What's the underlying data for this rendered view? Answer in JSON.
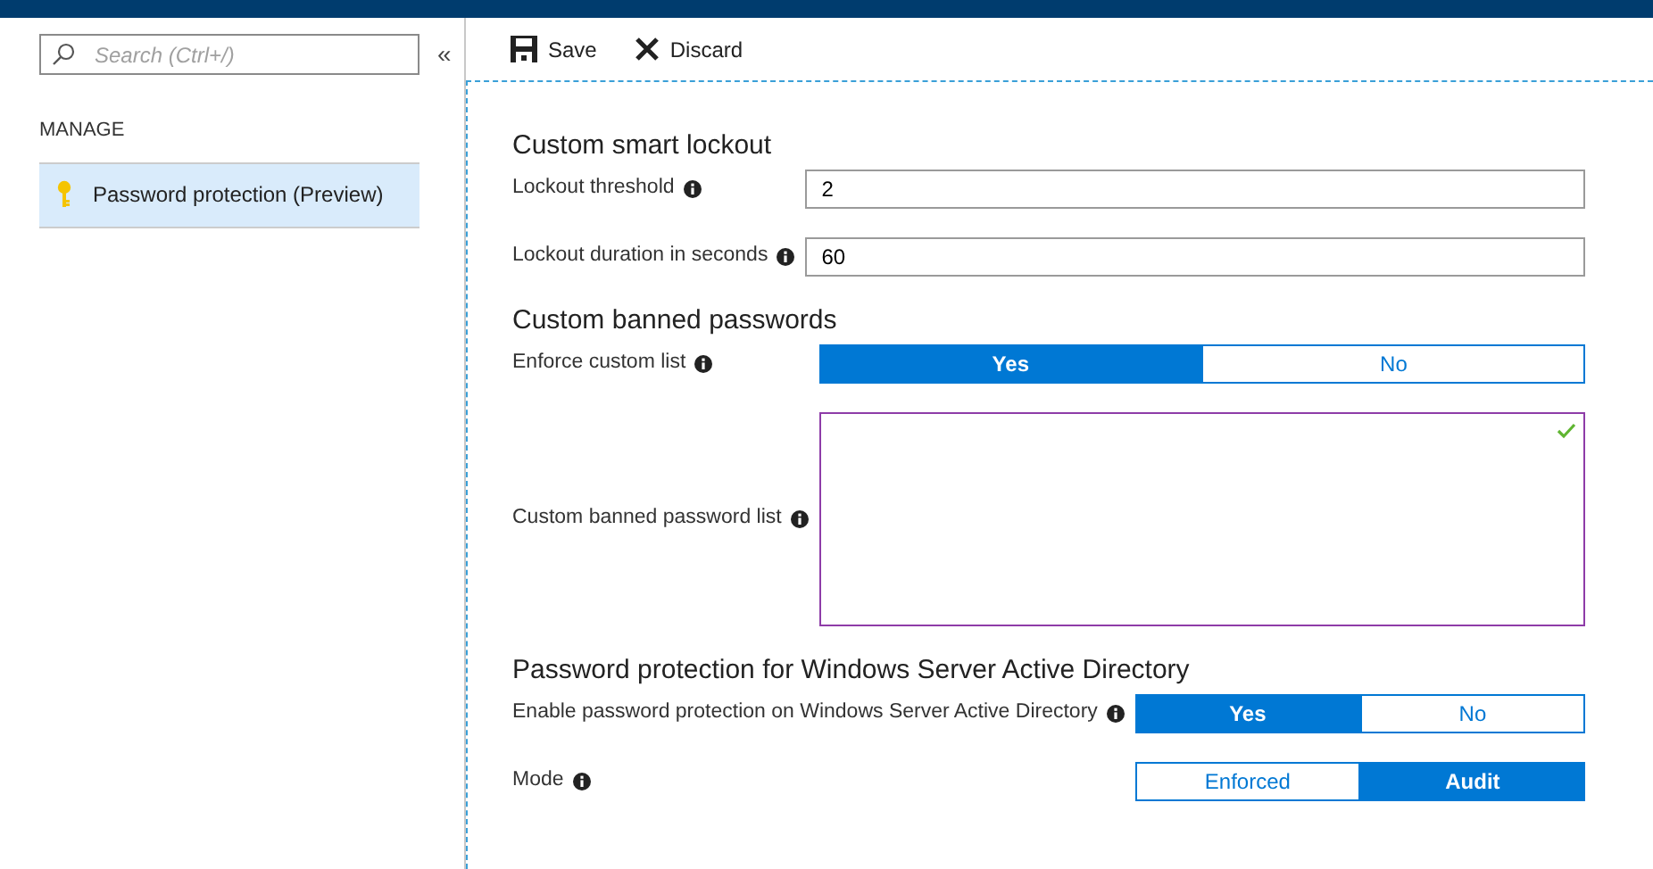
{
  "sidebar": {
    "search": {
      "placeholder": "Search (Ctrl+/)"
    },
    "collapse": "«",
    "section": "MANAGE",
    "items": [
      {
        "label": "Password protection (Preview)",
        "selected": true
      }
    ]
  },
  "toolbar": [
    {
      "kind": "save",
      "label": "Save"
    },
    {
      "kind": "discard",
      "label": "Discard"
    }
  ],
  "sections": [
    {
      "title": "Custom smart lockout",
      "fields": [
        {
          "kind": "text",
          "label": "Lockout threshold",
          "value": "2"
        },
        {
          "kind": "text",
          "label": "Lockout duration in seconds",
          "value": "60"
        }
      ]
    },
    {
      "title": "Custom banned passwords",
      "fields": [
        {
          "kind": "toggle",
          "label": "Enforce custom list",
          "options": [
            {
              "label": "Yes",
              "selected": true
            },
            {
              "label": "No",
              "selected": false
            }
          ]
        },
        {
          "kind": "textarea",
          "label": "Custom banned password list",
          "valid": true
        }
      ]
    },
    {
      "title": "Password protection for Windows Server Active Directory",
      "fields": [
        {
          "kind": "toggle",
          "label": "Enable password protection on Windows Server Active Directory",
          "options": [
            {
              "label": "Yes",
              "selected": true
            },
            {
              "label": "No",
              "selected": false
            }
          ]
        },
        {
          "kind": "toggle",
          "label": "Mode",
          "options": [
            {
              "label": "Enforced",
              "selected": false
            },
            {
              "label": "Audit",
              "selected": true
            }
          ]
        }
      ]
    }
  ]
}
